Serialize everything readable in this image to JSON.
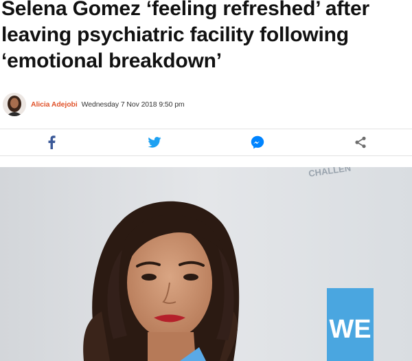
{
  "article": {
    "headline": "Selena Gomez ‘feeling refreshed’ after leaving psychiatric facility following ‘emotional breakdown’",
    "author": "Alicia Adejobi",
    "date": "Wednesday 7 Nov 2018 9:50 pm"
  },
  "share": {
    "buttons": [
      {
        "name": "facebook",
        "icon": "facebook-icon",
        "color": "#3b5998"
      },
      {
        "name": "twitter",
        "icon": "twitter-icon",
        "color": "#1da1f2"
      },
      {
        "name": "messenger",
        "icon": "messenger-icon",
        "color": "#0084ff"
      },
      {
        "name": "share",
        "icon": "share-icon",
        "color": "#6d6d6d"
      }
    ]
  },
  "hero": {
    "backdrop_logo": "WE"
  },
  "colors": {
    "author": "#e0532b",
    "divider": "#e2e2e2",
    "backdrop": "#dde0e4",
    "we_logo": "#4aa6e0"
  }
}
